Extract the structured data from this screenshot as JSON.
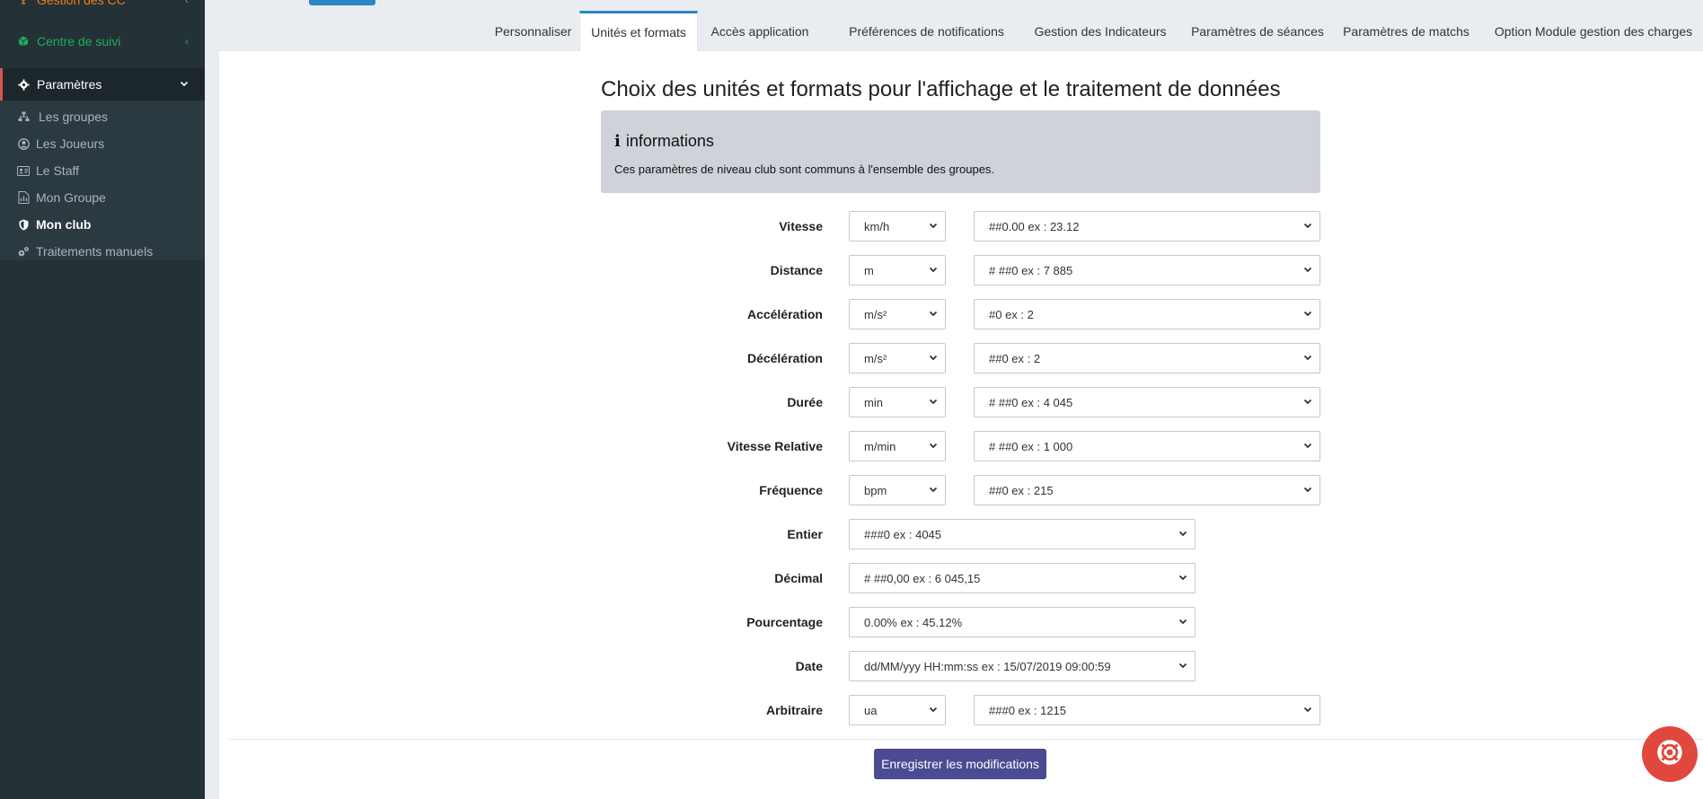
{
  "sidebar": {
    "gestion_cc": "Gestion des CC",
    "centre_suivi": "Centre de suivi",
    "parametres": "Paramètres",
    "sub_items": [
      {
        "label": "Les groupes",
        "icon": "sitemap-icon"
      },
      {
        "label": "Les Joueurs",
        "icon": "user-circle-icon"
      },
      {
        "label": "Le Staff",
        "icon": "id-card-icon"
      },
      {
        "label": "Mon Groupe",
        "icon": "chart-icon"
      },
      {
        "label": "Mon club",
        "icon": "shield-icon"
      },
      {
        "label": "Traitements manuels",
        "icon": "gears-icon"
      }
    ]
  },
  "tabs": [
    {
      "label": "Personnaliser"
    },
    {
      "label": "Unités et formats"
    },
    {
      "label": "Accès application"
    },
    {
      "label": "Préférences de notifications"
    },
    {
      "label": "Gestion des Indicateurs"
    },
    {
      "label": "Paramètres de séances"
    },
    {
      "label": "Paramètres de matchs"
    },
    {
      "label": "Option Module gestion des charges"
    }
  ],
  "main": {
    "title": "Choix des unités et formats pour l'affichage et le traitement de données",
    "info": {
      "title": "informations",
      "text": "Ces paramètres de niveau club sont communs à l'ensemble des groupes."
    },
    "rows": [
      {
        "label": "Vitesse",
        "unit": "km/h",
        "format": "##0.00 ex : 23.12"
      },
      {
        "label": "Distance",
        "unit": "m",
        "format": "# ##0 ex : 7 885"
      },
      {
        "label": "Accélération",
        "unit": "m/s²",
        "format": "#0 ex : 2"
      },
      {
        "label": "Décélération",
        "unit": "m/s²",
        "format": "##0 ex : 2"
      },
      {
        "label": "Durée",
        "unit": "min",
        "format": "# ##0 ex : 4 045"
      },
      {
        "label": "Vitesse Relative",
        "unit": "m/min",
        "format": "# ##0 ex : 1 000"
      },
      {
        "label": "Fréquence",
        "unit": "bpm",
        "format": "##0 ex : 215"
      },
      {
        "label": "Entier",
        "format": "###0 ex : 4045"
      },
      {
        "label": "Décimal",
        "format": "# ##0,00 ex : 6 045,15"
      },
      {
        "label": "Pourcentage",
        "format": "0.00% ex : 45.12%"
      },
      {
        "label": "Date",
        "format": "dd/MM/yyy HH:mm:ss ex : 15/07/2019 09:00:59"
      },
      {
        "label": "Arbitraire",
        "unit": "ua",
        "format": "###0 ex : 1215"
      }
    ],
    "save_label": "Enregistrer les modifications"
  },
  "colors": {
    "sidebar_bg": "#243137",
    "accent_blue": "#2a86c4",
    "orange": "#ee7d16",
    "green": "#1ead5b",
    "save_button": "#4c4a93",
    "help_button": "#e0483e"
  }
}
